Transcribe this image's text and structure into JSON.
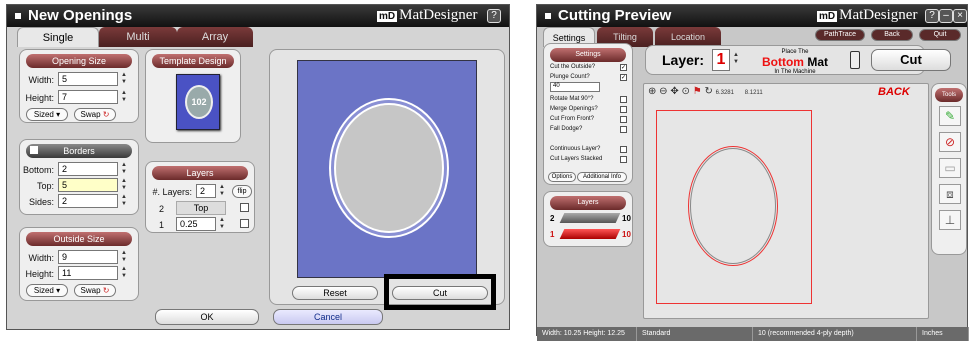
{
  "left": {
    "title": "New Openings",
    "brand_logo": "mD",
    "brand_name": "MatDesigner",
    "help_icon": "?",
    "tabs": [
      "Single",
      "Multi",
      "Array"
    ],
    "opening_size": {
      "heading": "Opening Size",
      "width_label": "Width:",
      "width": "5",
      "height_label": "Height:",
      "height": "7",
      "sized": "Sized",
      "swap": "Swap"
    },
    "template": {
      "heading": "Template Design",
      "number": "102"
    },
    "borders": {
      "heading": "Borders",
      "bottom_label": "Bottom:",
      "bottom": "2",
      "top_label": "Top:",
      "top": "5",
      "sides_label": "Sides:",
      "sides": "2"
    },
    "layers": {
      "heading": "Layers",
      "count_label": "#. Layers:",
      "count": "2",
      "flip": "flip",
      "row2_num": "2",
      "row2_name": "Top",
      "row1_num": "1",
      "row1_val": "0.25"
    },
    "outside_size": {
      "heading": "Outside Size",
      "width_label": "Width:",
      "width": "9",
      "height_label": "Height:",
      "height": "11",
      "sized": "Sized",
      "swap": "Swap"
    },
    "reset": "Reset",
    "cut": "Cut",
    "ok": "OK",
    "cancel": "Cancel",
    "colors": {
      "mat": "#6b74c6",
      "accent": "#7a3030"
    }
  },
  "right": {
    "title": "Cutting Preview",
    "brand_logo": "mD",
    "brand_name": "MatDesigner",
    "tabs": [
      "Settings",
      "Tilting",
      "Location"
    ],
    "top_buttons": [
      "PathTrace",
      "Back",
      "Quit"
    ],
    "settings": {
      "heading": "Settings",
      "items": [
        {
          "label": "Cut the Outside?",
          "checked": true
        },
        {
          "label": "Plunge Count?",
          "checked": true
        },
        {
          "label": "Rotate Mat 90°?",
          "checked": false
        },
        {
          "label": "Merge Openings?",
          "checked": false
        },
        {
          "label": "Cut From Front?",
          "checked": false
        },
        {
          "label": "Fall Dodge?",
          "checked": false
        },
        {
          "label": "Continuous Layer?",
          "checked": false
        },
        {
          "label": "Cut Layers Stacked",
          "checked": false
        }
      ],
      "plunge_value": "40",
      "tab_options": "Options",
      "tab_info": "Additional Info"
    },
    "layer_bar": {
      "label": "Layer:",
      "value": "1",
      "place_line1": "Place The",
      "place_bottom": "Bottom",
      "place_mat": "Mat",
      "place_line2": "In The Machine",
      "cut": "Cut"
    },
    "coords": {
      "x": "6.3281",
      "y": "8.1211"
    },
    "back_label": "BACK",
    "layers_panel": {
      "heading": "Layers",
      "rows": [
        {
          "num": "2",
          "val": "10"
        },
        {
          "num": "1",
          "val": "10"
        }
      ]
    },
    "tools_heading": "Tools",
    "status": [
      "Width: 10.25  Height: 12.25",
      "Standard",
      "10 (recommended 4-ply depth)",
      "Inches"
    ],
    "colors": {
      "accent": "#cc1111"
    }
  }
}
